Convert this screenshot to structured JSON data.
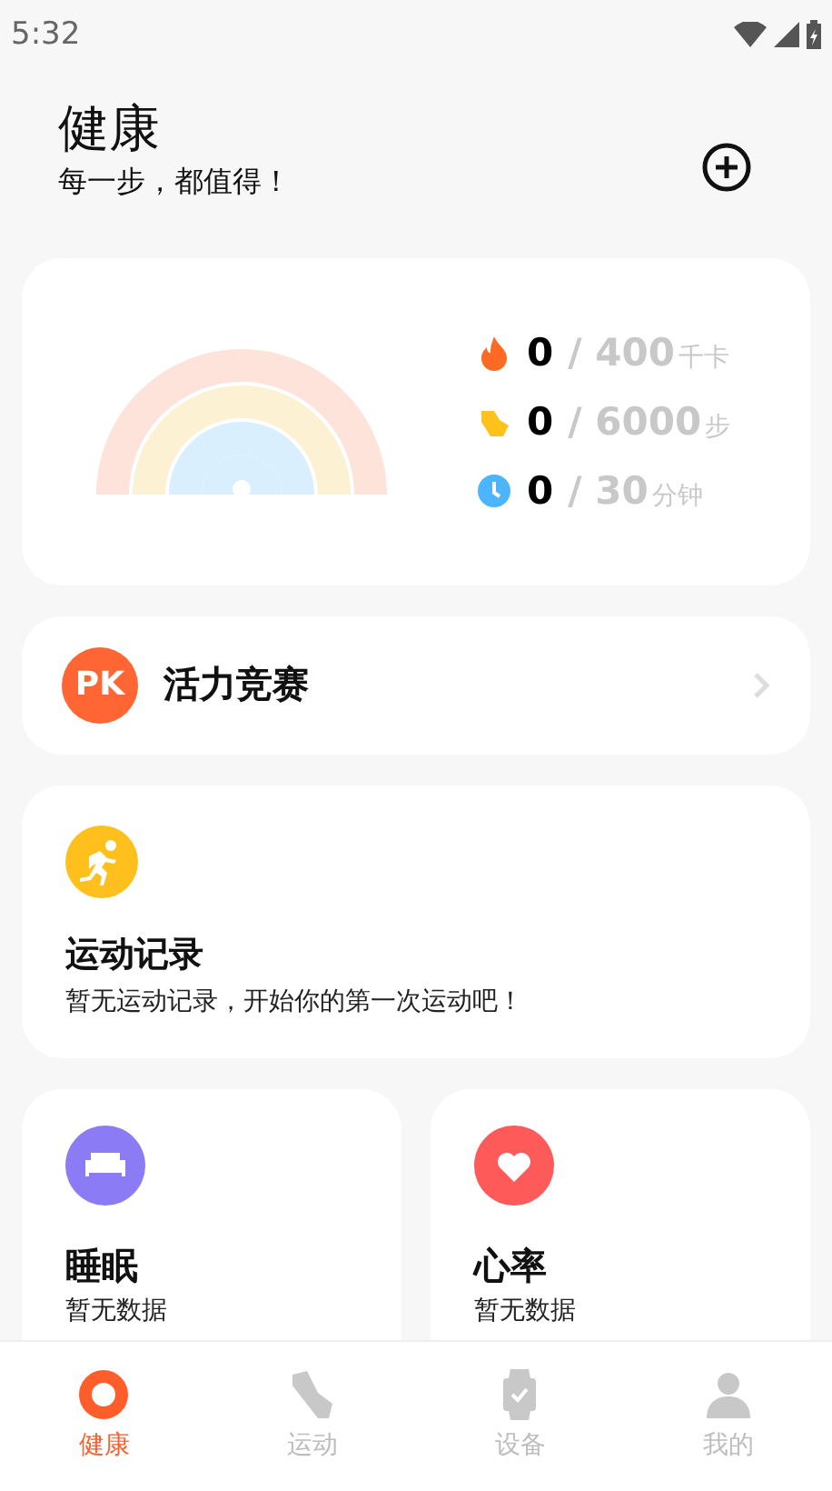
{
  "status_bar": {
    "time": "5:32"
  },
  "header": {
    "title": "健康",
    "subtitle": "每一步，都值得！"
  },
  "summary": {
    "stats": [
      {
        "kind": "calories",
        "value": "0",
        "goal": "/ 400",
        "unit": "千卡",
        "color": "#ff6a22"
      },
      {
        "kind": "steps",
        "value": "0",
        "goal": "/ 6000",
        "unit": "步",
        "color": "#ffc21a"
      },
      {
        "kind": "duration",
        "value": "0",
        "goal": "/ 30",
        "unit": "分钟",
        "color": "#4db4ff"
      }
    ]
  },
  "competition": {
    "badge": "PK",
    "title": "活力竞赛"
  },
  "records": {
    "title": "运动记录",
    "message": "暂无运动记录，开始你的第一次运动吧！"
  },
  "tiles": [
    {
      "kind": "sleep",
      "title": "睡眠",
      "message": "暂无数据"
    },
    {
      "kind": "heart",
      "title": "心率",
      "message": "暂无数据"
    }
  ],
  "nav": [
    {
      "kind": "health",
      "label": "健康",
      "selected": true
    },
    {
      "kind": "sport",
      "label": "运动",
      "selected": false
    },
    {
      "kind": "device",
      "label": "设备",
      "selected": false
    },
    {
      "kind": "profile",
      "label": "我的",
      "selected": false
    }
  ]
}
